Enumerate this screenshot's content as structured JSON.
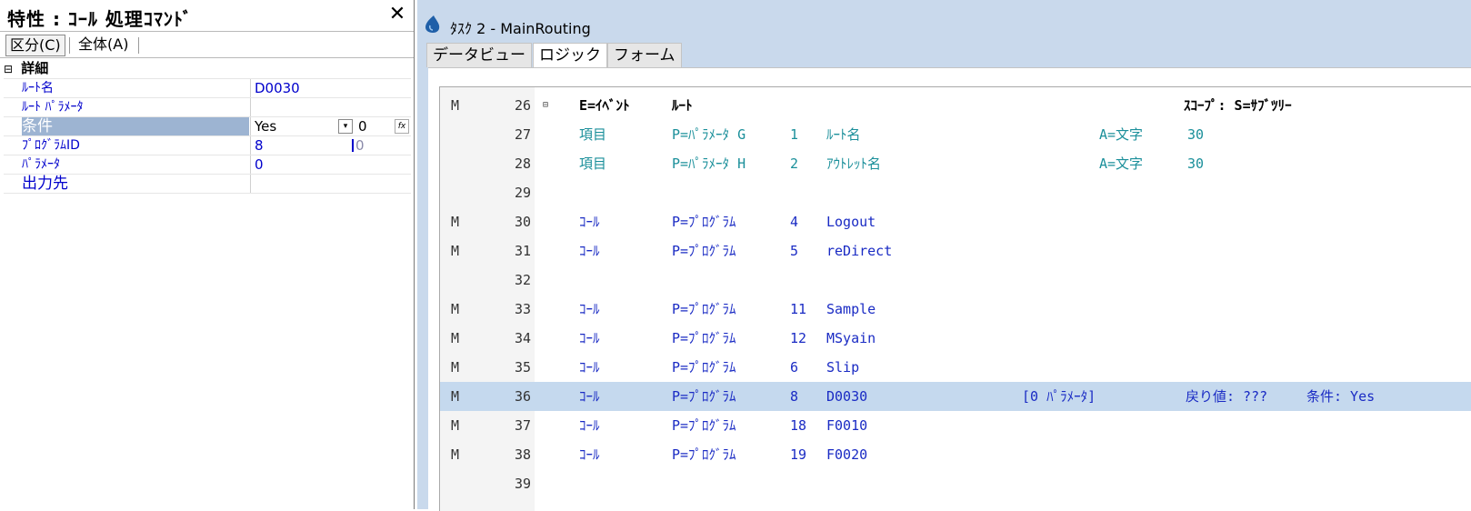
{
  "properties_panel": {
    "title": "特性 : ｺｰﾙ 処理ｺﾏﾝﾄﾞ",
    "close_glyph": "✕",
    "tabs": [
      "区分(C)",
      "全体(A)"
    ],
    "category_toggle": "⊟",
    "category": "詳細",
    "rows": [
      {
        "name": "ﾙｰﾄ名",
        "value": "D0030"
      },
      {
        "name": "ﾙｰﾄ ﾊﾟﾗﾒｰﾀ",
        "value": ""
      },
      {
        "name": "条件",
        "value": "Yes",
        "number": "0"
      },
      {
        "name": "ﾌﾟﾛｸﾞﾗﾑID",
        "value": "8",
        "extra": "0"
      },
      {
        "name": "ﾊﾟﾗﾒｰﾀ",
        "value": "0"
      },
      {
        "name": "出力先",
        "value": ""
      }
    ],
    "condition_dropdown_glyph": "▾",
    "condition_fx_glyph": "fx"
  },
  "editor_window": {
    "title": "ﾀｽｸ 2 -  MainRouting",
    "tabs": [
      "データビュー",
      "ロジック",
      "フォーム"
    ],
    "active_tab": "ロジック",
    "colors": {
      "selected_row": "#c5d9ee",
      "teal": "#1a8f9a",
      "blue": "#1a2bc4"
    },
    "header_line": {
      "number": "26",
      "mark": "M",
      "toggle": "⊟",
      "event": "E=ｲﾍﾞﾝﾄ",
      "route": "ﾙｰﾄ",
      "scope": "ｽｺｰﾌﾟ: S=ｻﾌﾞﾂﾘｰ"
    },
    "lines": [
      {
        "number": "27",
        "mark": "",
        "cmd": "項目",
        "type": "P=ﾊﾟﾗﾒｰﾀ G",
        "id": "1",
        "name": "ﾙｰﾄ名",
        "attr": "A=文字",
        "size": "30"
      },
      {
        "number": "28",
        "mark": "",
        "cmd": "項目",
        "type": "P=ﾊﾟﾗﾒｰﾀ H",
        "id": "2",
        "name": "ｱｳﾄﾚｯﾄ名",
        "attr": "A=文字",
        "size": "30"
      },
      {
        "number": "29",
        "mark": ""
      },
      {
        "number": "30",
        "mark": "M",
        "cmd": "ｺｰﾙ",
        "type": "P=ﾌﾟﾛｸﾞﾗﾑ",
        "id": "4",
        "name": "Logout"
      },
      {
        "number": "31",
        "mark": "M",
        "cmd": "ｺｰﾙ",
        "type": "P=ﾌﾟﾛｸﾞﾗﾑ",
        "id": "5",
        "name": "reDirect"
      },
      {
        "number": "32",
        "mark": ""
      },
      {
        "number": "33",
        "mark": "M",
        "cmd": "ｺｰﾙ",
        "type": "P=ﾌﾟﾛｸﾞﾗﾑ",
        "id": "11",
        "name": "Sample"
      },
      {
        "number": "34",
        "mark": "M",
        "cmd": "ｺｰﾙ",
        "type": "P=ﾌﾟﾛｸﾞﾗﾑ",
        "id": "12",
        "name": "MSyain"
      },
      {
        "number": "35",
        "mark": "M",
        "cmd": "ｺｰﾙ",
        "type": "P=ﾌﾟﾛｸﾞﾗﾑ",
        "id": "6",
        "name": "Slip"
      },
      {
        "number": "36",
        "mark": "M",
        "cmd": "ｺｰﾙ",
        "type": "P=ﾌﾟﾛｸﾞﾗﾑ",
        "id": "8",
        "name": "D0030",
        "params": "[0 ﾊﾟﾗﾒｰﾀ]",
        "ret": "戻り値:  ???",
        "cond": "条件: Yes",
        "selected": true
      },
      {
        "number": "37",
        "mark": "M",
        "cmd": "ｺｰﾙ",
        "type": "P=ﾌﾟﾛｸﾞﾗﾑ",
        "id": "18",
        "name": "F0010"
      },
      {
        "number": "38",
        "mark": "M",
        "cmd": "ｺｰﾙ",
        "type": "P=ﾌﾟﾛｸﾞﾗﾑ",
        "id": "19",
        "name": "F0020"
      },
      {
        "number": "39",
        "mark": ""
      }
    ]
  }
}
